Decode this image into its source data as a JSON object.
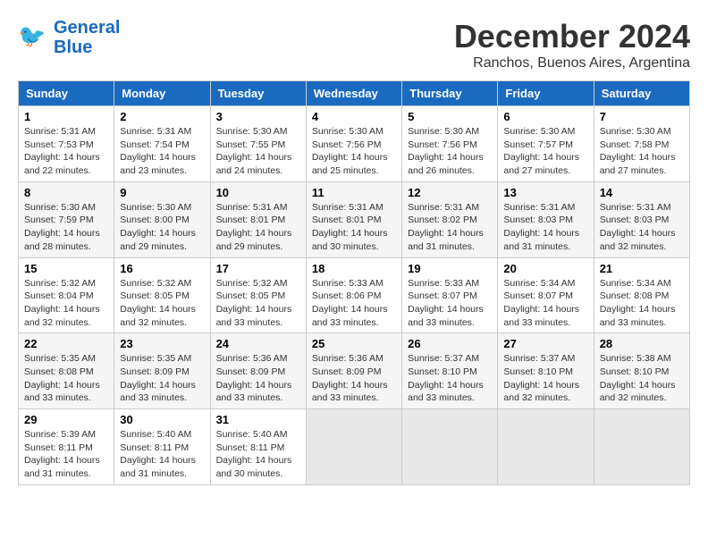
{
  "logo": {
    "line1": "General",
    "line2": "Blue"
  },
  "title": "December 2024",
  "location": "Ranchos, Buenos Aires, Argentina",
  "days_of_week": [
    "Sunday",
    "Monday",
    "Tuesday",
    "Wednesday",
    "Thursday",
    "Friday",
    "Saturday"
  ],
  "weeks": [
    [
      {
        "day": "1",
        "sunrise": "Sunrise: 5:31 AM",
        "sunset": "Sunset: 7:53 PM",
        "daylight": "Daylight: 14 hours and 22 minutes."
      },
      {
        "day": "2",
        "sunrise": "Sunrise: 5:31 AM",
        "sunset": "Sunset: 7:54 PM",
        "daylight": "Daylight: 14 hours and 23 minutes."
      },
      {
        "day": "3",
        "sunrise": "Sunrise: 5:30 AM",
        "sunset": "Sunset: 7:55 PM",
        "daylight": "Daylight: 14 hours and 24 minutes."
      },
      {
        "day": "4",
        "sunrise": "Sunrise: 5:30 AM",
        "sunset": "Sunset: 7:56 PM",
        "daylight": "Daylight: 14 hours and 25 minutes."
      },
      {
        "day": "5",
        "sunrise": "Sunrise: 5:30 AM",
        "sunset": "Sunset: 7:56 PM",
        "daylight": "Daylight: 14 hours and 26 minutes."
      },
      {
        "day": "6",
        "sunrise": "Sunrise: 5:30 AM",
        "sunset": "Sunset: 7:57 PM",
        "daylight": "Daylight: 14 hours and 27 minutes."
      },
      {
        "day": "7",
        "sunrise": "Sunrise: 5:30 AM",
        "sunset": "Sunset: 7:58 PM",
        "daylight": "Daylight: 14 hours and 27 minutes."
      }
    ],
    [
      {
        "day": "8",
        "sunrise": "Sunrise: 5:30 AM",
        "sunset": "Sunset: 7:59 PM",
        "daylight": "Daylight: 14 hours and 28 minutes."
      },
      {
        "day": "9",
        "sunrise": "Sunrise: 5:30 AM",
        "sunset": "Sunset: 8:00 PM",
        "daylight": "Daylight: 14 hours and 29 minutes."
      },
      {
        "day": "10",
        "sunrise": "Sunrise: 5:31 AM",
        "sunset": "Sunset: 8:01 PM",
        "daylight": "Daylight: 14 hours and 29 minutes."
      },
      {
        "day": "11",
        "sunrise": "Sunrise: 5:31 AM",
        "sunset": "Sunset: 8:01 PM",
        "daylight": "Daylight: 14 hours and 30 minutes."
      },
      {
        "day": "12",
        "sunrise": "Sunrise: 5:31 AM",
        "sunset": "Sunset: 8:02 PM",
        "daylight": "Daylight: 14 hours and 31 minutes."
      },
      {
        "day": "13",
        "sunrise": "Sunrise: 5:31 AM",
        "sunset": "Sunset: 8:03 PM",
        "daylight": "Daylight: 14 hours and 31 minutes."
      },
      {
        "day": "14",
        "sunrise": "Sunrise: 5:31 AM",
        "sunset": "Sunset: 8:03 PM",
        "daylight": "Daylight: 14 hours and 32 minutes."
      }
    ],
    [
      {
        "day": "15",
        "sunrise": "Sunrise: 5:32 AM",
        "sunset": "Sunset: 8:04 PM",
        "daylight": "Daylight: 14 hours and 32 minutes."
      },
      {
        "day": "16",
        "sunrise": "Sunrise: 5:32 AM",
        "sunset": "Sunset: 8:05 PM",
        "daylight": "Daylight: 14 hours and 32 minutes."
      },
      {
        "day": "17",
        "sunrise": "Sunrise: 5:32 AM",
        "sunset": "Sunset: 8:05 PM",
        "daylight": "Daylight: 14 hours and 33 minutes."
      },
      {
        "day": "18",
        "sunrise": "Sunrise: 5:33 AM",
        "sunset": "Sunset: 8:06 PM",
        "daylight": "Daylight: 14 hours and 33 minutes."
      },
      {
        "day": "19",
        "sunrise": "Sunrise: 5:33 AM",
        "sunset": "Sunset: 8:07 PM",
        "daylight": "Daylight: 14 hours and 33 minutes."
      },
      {
        "day": "20",
        "sunrise": "Sunrise: 5:34 AM",
        "sunset": "Sunset: 8:07 PM",
        "daylight": "Daylight: 14 hours and 33 minutes."
      },
      {
        "day": "21",
        "sunrise": "Sunrise: 5:34 AM",
        "sunset": "Sunset: 8:08 PM",
        "daylight": "Daylight: 14 hours and 33 minutes."
      }
    ],
    [
      {
        "day": "22",
        "sunrise": "Sunrise: 5:35 AM",
        "sunset": "Sunset: 8:08 PM",
        "daylight": "Daylight: 14 hours and 33 minutes."
      },
      {
        "day": "23",
        "sunrise": "Sunrise: 5:35 AM",
        "sunset": "Sunset: 8:09 PM",
        "daylight": "Daylight: 14 hours and 33 minutes."
      },
      {
        "day": "24",
        "sunrise": "Sunrise: 5:36 AM",
        "sunset": "Sunset: 8:09 PM",
        "daylight": "Daylight: 14 hours and 33 minutes."
      },
      {
        "day": "25",
        "sunrise": "Sunrise: 5:36 AM",
        "sunset": "Sunset: 8:09 PM",
        "daylight": "Daylight: 14 hours and 33 minutes."
      },
      {
        "day": "26",
        "sunrise": "Sunrise: 5:37 AM",
        "sunset": "Sunset: 8:10 PM",
        "daylight": "Daylight: 14 hours and 33 minutes."
      },
      {
        "day": "27",
        "sunrise": "Sunrise: 5:37 AM",
        "sunset": "Sunset: 8:10 PM",
        "daylight": "Daylight: 14 hours and 32 minutes."
      },
      {
        "day": "28",
        "sunrise": "Sunrise: 5:38 AM",
        "sunset": "Sunset: 8:10 PM",
        "daylight": "Daylight: 14 hours and 32 minutes."
      }
    ],
    [
      {
        "day": "29",
        "sunrise": "Sunrise: 5:39 AM",
        "sunset": "Sunset: 8:11 PM",
        "daylight": "Daylight: 14 hours and 31 minutes."
      },
      {
        "day": "30",
        "sunrise": "Sunrise: 5:40 AM",
        "sunset": "Sunset: 8:11 PM",
        "daylight": "Daylight: 14 hours and 31 minutes."
      },
      {
        "day": "31",
        "sunrise": "Sunrise: 5:40 AM",
        "sunset": "Sunset: 8:11 PM",
        "daylight": "Daylight: 14 hours and 30 minutes."
      },
      null,
      null,
      null,
      null
    ]
  ]
}
